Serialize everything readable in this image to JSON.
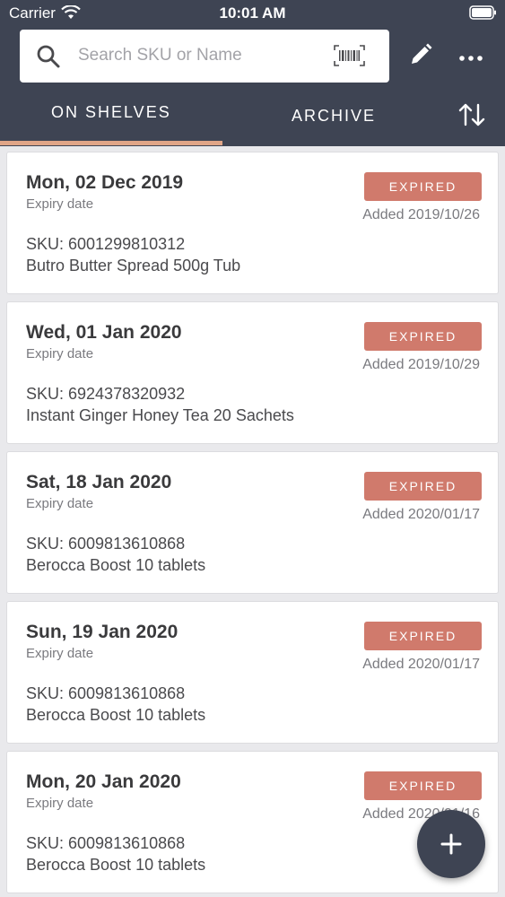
{
  "status_bar": {
    "carrier": "Carrier",
    "time": "10:01 AM"
  },
  "search": {
    "placeholder": "Search SKU or Name",
    "value": ""
  },
  "tabs": [
    {
      "label": "ON SHELVES",
      "active": true
    },
    {
      "label": "ARCHIVE",
      "active": false
    }
  ],
  "colors": {
    "header": "#3e4453",
    "active_tab_underline": "#e0a587",
    "expired_badge": "#d07a6c"
  },
  "items": [
    {
      "date": "Mon, 02 Dec 2019",
      "expiry_label": "Expiry date",
      "status": "EXPIRED",
      "added": "Added 2019/10/26",
      "sku": "SKU: 6001299810312",
      "name": "Butro Butter Spread 500g Tub"
    },
    {
      "date": "Wed, 01 Jan 2020",
      "expiry_label": "Expiry date",
      "status": "EXPIRED",
      "added": "Added 2019/10/29",
      "sku": "SKU: 6924378320932",
      "name": "Instant Ginger Honey Tea 20 Sachets"
    },
    {
      "date": "Sat, 18 Jan 2020",
      "expiry_label": "Expiry date",
      "status": "EXPIRED",
      "added": "Added 2020/01/17",
      "sku": "SKU: 6009813610868",
      "name": "Berocca Boost 10 tablets"
    },
    {
      "date": "Sun, 19 Jan 2020",
      "expiry_label": "Expiry date",
      "status": "EXPIRED",
      "added": "Added 2020/01/17",
      "sku": "SKU: 6009813610868",
      "name": "Berocca Boost 10 tablets"
    },
    {
      "date": "Mon, 20 Jan 2020",
      "expiry_label": "Expiry date",
      "status": "EXPIRED",
      "added": "Added 2020/01/16",
      "sku": "SKU: 6009813610868",
      "name": "Berocca Boost 10 tablets"
    }
  ],
  "icons": {
    "search": "search-icon",
    "barcode": "barcode-icon",
    "edit": "pencil-icon",
    "more": "more-dots-icon",
    "sort": "sort-arrows-icon",
    "add": "plus-icon"
  }
}
